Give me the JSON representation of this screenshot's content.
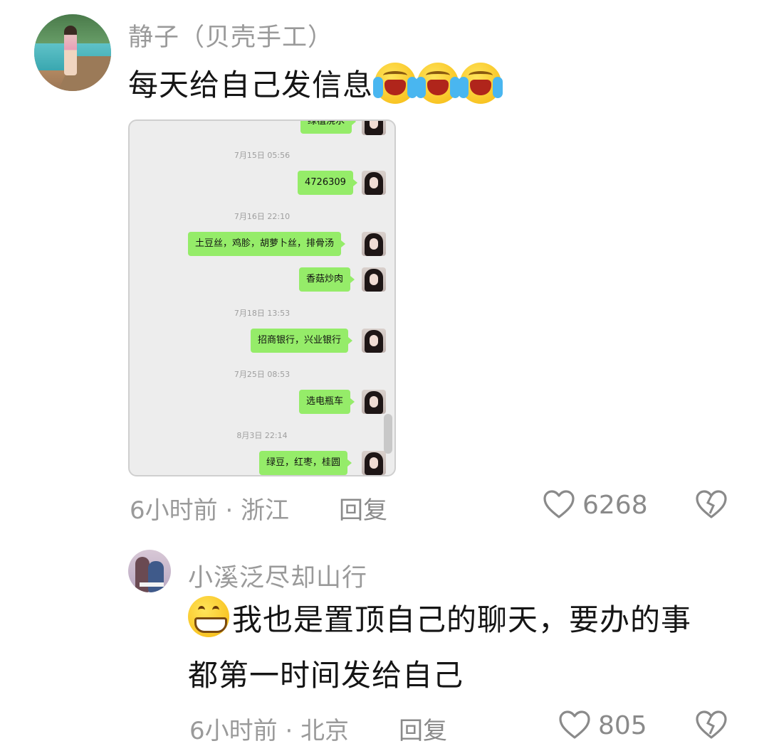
{
  "comments": [
    {
      "username": "静子（贝壳手工）",
      "text": "每天给自己发信息",
      "emoji": [
        "loudly-crying-face-icon",
        "loudly-crying-face-icon",
        "loudly-crying-face-icon"
      ],
      "meta": "6小时前 · 浙江",
      "reply": "回复",
      "likes": "6268",
      "chat_screenshot": {
        "partial_top": "绿植浇水",
        "messages": [
          {
            "time": "7月15日 05:56",
            "bubbles": [
              "4726309"
            ]
          },
          {
            "time": "7月16日 22:10",
            "bubbles": [
              "土豆丝，鸡胗，胡萝卜丝，排骨汤",
              "香菇炒肉"
            ]
          },
          {
            "time": "7月18日 13:53",
            "bubbles": [
              "招商银行，兴业银行"
            ]
          },
          {
            "time": "7月25日 08:53",
            "bubbles": [
              "选电瓶车"
            ]
          },
          {
            "time": "8月3日 22:14",
            "bubbles": [
              "绿豆，红枣，桂圆"
            ]
          }
        ]
      }
    },
    {
      "username": "小溪泛尽却山行",
      "emoji": "grinning-face-icon",
      "text_line1": "我也是置顶自己的聊天，要办的事",
      "text_line2": "都第一时间发给自己",
      "meta": "6小时前 · 北京",
      "reply": "回复",
      "likes": "805"
    }
  ],
  "colors": {
    "bubble_green": "#95ec69",
    "meta_gray": "#9a9a9a",
    "text_black": "#151515"
  }
}
